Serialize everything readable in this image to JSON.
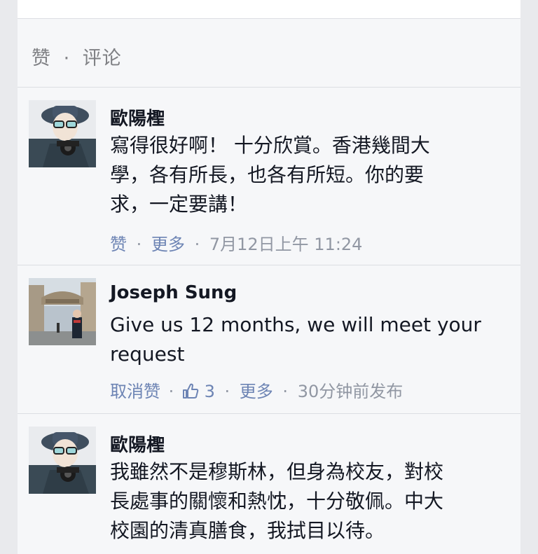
{
  "feed": {
    "actions": {
      "like": "赞",
      "sep": "·",
      "comment": "评论"
    },
    "comments": [
      {
        "name": "歐陽檉",
        "lines": [
          "寫得很好啊！ 十分欣賞。香港幾間大",
          "學，各有所長，也各有所短。你的要",
          "求，一定要講！"
        ],
        "meta": {
          "action1": "赞",
          "sep": "·",
          "more": "更多",
          "time": "7月12日上午 11:24"
        }
      },
      {
        "name": "Joseph Sung",
        "lines": [
          "Give us 12 months, we will meet your",
          "request"
        ],
        "meta": {
          "action1": "取消赞",
          "sep": "·",
          "likes": "3",
          "more": "更多",
          "time": "30分钟前发布"
        }
      },
      {
        "name": "歐陽檉",
        "lines": [
          "我雖然不是穆斯林，但身為校友，對校",
          "長處事的關懷和熱忱，十分敬佩。中大",
          "校園的清真膳食，我拭目以待。"
        ],
        "meta": {}
      }
    ]
  },
  "colors": {
    "background": "#e9eaed",
    "card": "#f6f7f9",
    "name_text": "#141823",
    "meta_text": "#9197a3",
    "link": "#6d84b4"
  },
  "icons": [
    "avatar-hat-man",
    "avatar-bridge-photo",
    "thumbs-up-icon"
  ]
}
